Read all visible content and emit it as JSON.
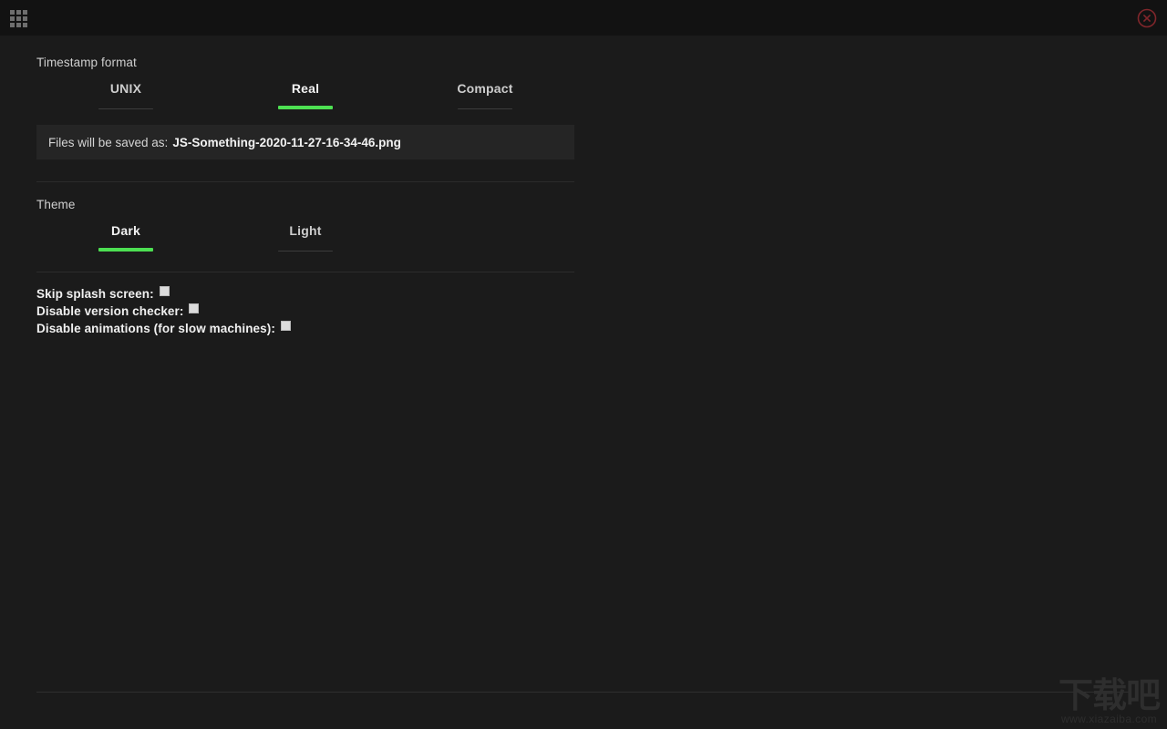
{
  "titlebar": {
    "menu_icon": "grid-apps-icon",
    "close_icon": "close-circle-icon"
  },
  "timestamp_section": {
    "label": "Timestamp format",
    "tabs": [
      {
        "label": "UNIX",
        "active": false
      },
      {
        "label": "Real",
        "active": true
      },
      {
        "label": "Compact",
        "active": false
      }
    ],
    "info": {
      "prefix": "Files will be saved as:",
      "filename": "JS-Something-2020-11-27-16-34-46.png"
    }
  },
  "theme_section": {
    "label": "Theme",
    "tabs": [
      {
        "label": "Dark",
        "active": true
      },
      {
        "label": "Light",
        "active": false
      }
    ]
  },
  "options_section": {
    "options": [
      {
        "label": "Skip splash screen:",
        "checked": false
      },
      {
        "label": "Disable version checker:",
        "checked": false
      },
      {
        "label": "Disable animations (for slow machines):",
        "checked": false
      }
    ]
  },
  "watermark": {
    "cn": "下载吧",
    "url": "www.xiazaiba.com"
  },
  "colors": {
    "accent_green": "#4de052",
    "close_red": "#7a1f1f",
    "titlebar_bg": "#121212",
    "body_bg": "#1b1b1b",
    "infobar_bg": "#252525"
  }
}
